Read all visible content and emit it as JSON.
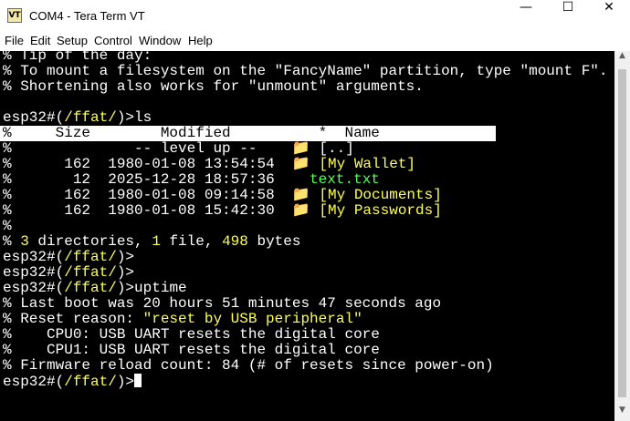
{
  "window": {
    "title": "COM4 - Tera Term VT",
    "app_icon_text": "VT",
    "icon": "teraterm-vt-icon",
    "controls": {
      "minimize": "—",
      "maximize": "☐",
      "close": "✕"
    }
  },
  "menu": [
    "File",
    "Edit",
    "Setup",
    "Control",
    "Window",
    "Help"
  ],
  "terminal": {
    "tip_lines": [
      "% Tip of the day:",
      "% To mount a filesystem on the \"FancyName\" partition, type \"mount F\".",
      "% Shortening also works for \"unmount\" arguments."
    ],
    "prompt_prefix": "esp32#(",
    "prompt_path": "/ffat/",
    "prompt_suffix": ")>",
    "ls_command": "ls",
    "ls_header": "%     Size        Modified          *  Name",
    "ls_rows": [
      {
        "pct": "%",
        "size": "",
        "modified": "-- level up --",
        "icon": "📁",
        "name": "[..]",
        "color": "white"
      },
      {
        "pct": "%",
        "size": "162",
        "modified": "1980-01-08 13:54:54",
        "icon": "📁",
        "name": "[My Wallet]",
        "color": "yellow"
      },
      {
        "pct": "%",
        "size": "12",
        "modified": "2025-12-28 18:57:36",
        "icon": "",
        "name": "text.txt",
        "color": "green"
      },
      {
        "pct": "%",
        "size": "162",
        "modified": "1980-01-08 09:14:58",
        "icon": "📁",
        "name": "[My Documents]",
        "color": "yellow"
      },
      {
        "pct": "%",
        "size": "162",
        "modified": "1980-01-08 15:42:30",
        "icon": "📁",
        "name": "[My Passwords]",
        "color": "yellow"
      },
      {
        "pct": "%",
        "size": "",
        "modified": "",
        "icon": "",
        "name": "",
        "color": "white"
      }
    ],
    "summary": {
      "prefix": "% ",
      "dirs": "3",
      "dirs_label": " directories, ",
      "files": "1",
      "files_label": " file, ",
      "bytes": "498",
      "bytes_label": " bytes"
    },
    "uptime_command": "uptime",
    "uptime_lines": {
      "last_boot": "% Last boot was 20 hours 51 minutes 47 seconds ago",
      "reset_label": "% Reset reason: ",
      "reset_value": "\"reset by USB peripheral\"",
      "cpu0": "%    CPU0: USB UART resets the digital core",
      "cpu1": "%    CPU1: USB UART resets the digital core",
      "reload": "% Firmware reload count: 84 (# of resets since power-on)"
    }
  }
}
